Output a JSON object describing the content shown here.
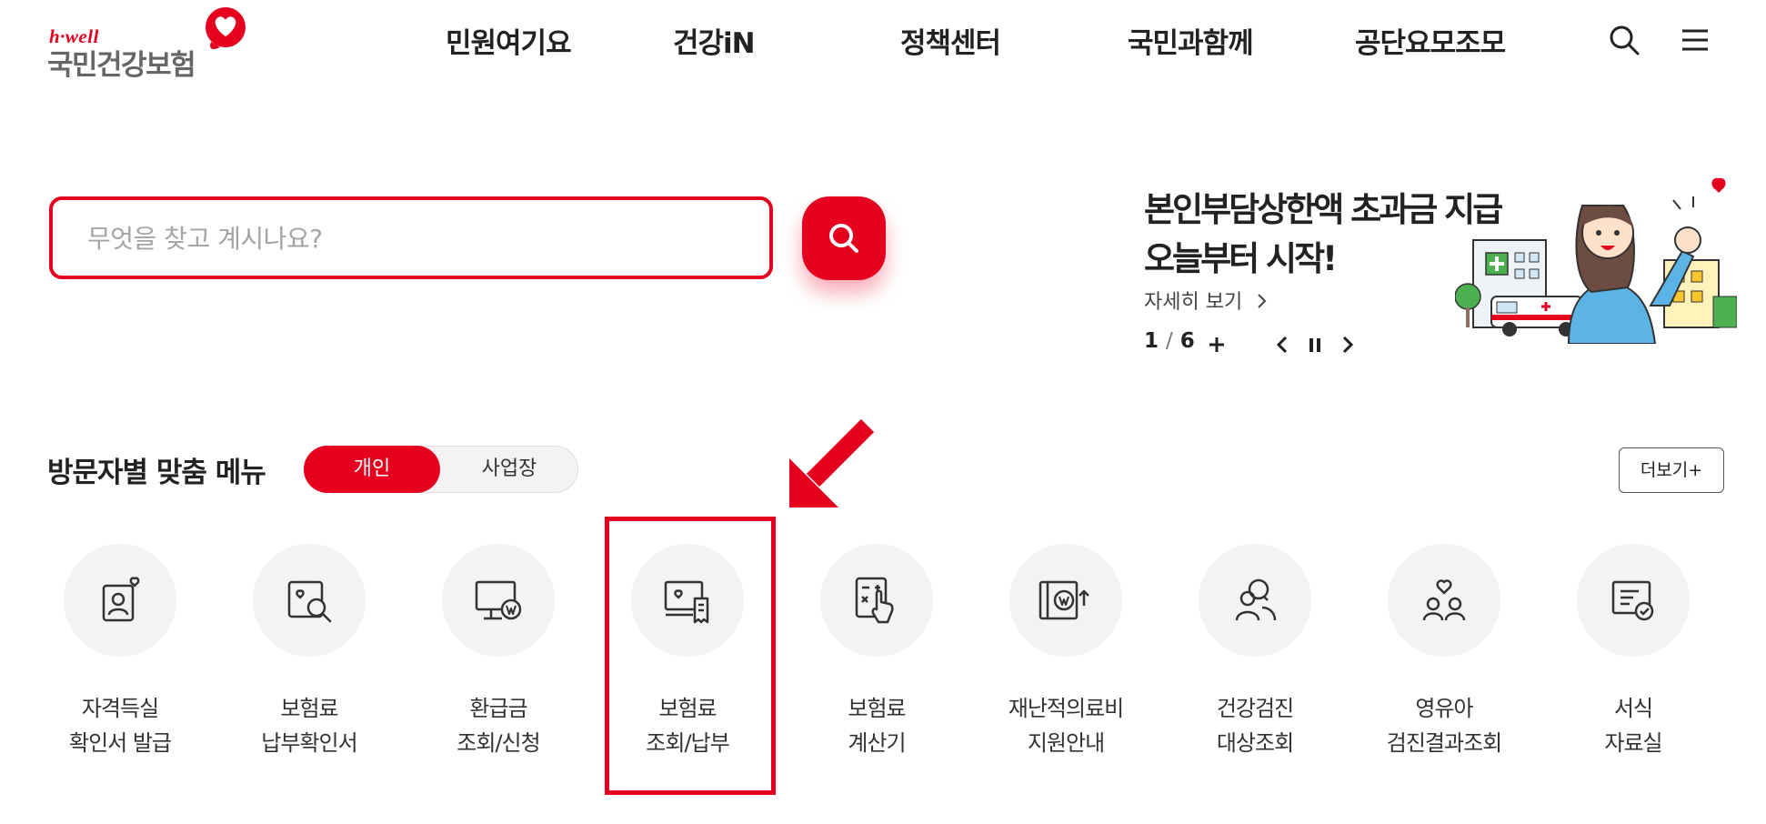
{
  "header": {
    "logo_small": "h·well",
    "logo_main": "국민건강보험",
    "nav": [
      "민원여기요",
      "건강iN",
      "정책센터",
      "국민과함께",
      "공단요모조모"
    ],
    "icons": [
      "search-icon",
      "hamburger-menu-icon"
    ]
  },
  "search": {
    "placeholder": "무엇을 찾고 계시나요?",
    "button_icon": "search-icon"
  },
  "banner": {
    "title_line1": "본인부담상한액 초과금 지급",
    "title_line2": "오늘부터 시작!",
    "more": "자세히 보기",
    "current": "1",
    "separator": "/",
    "total": "6",
    "controls": [
      "plus-icon",
      "prev-icon",
      "pause-icon",
      "next-icon"
    ]
  },
  "visitor_menu": {
    "title": "방문자별 맞춤 메뉴",
    "tab_active": "개인",
    "tab_inactive": "사업장",
    "more_button": "더보기+"
  },
  "quick_menu": [
    {
      "line1": "자격득실",
      "line2": "확인서 발급",
      "icon": "id-card-heart-icon"
    },
    {
      "line1": "보험료",
      "line2": "납부확인서",
      "icon": "document-search-icon"
    },
    {
      "line1": "환급금",
      "line2": "조회/신청",
      "icon": "monitor-won-icon"
    },
    {
      "line1": "보험료",
      "line2": "조회/납부",
      "icon": "monitor-receipt-icon"
    },
    {
      "line1": "보험료",
      "line2": "계산기",
      "icon": "calculator-hand-icon"
    },
    {
      "line1": "재난적의료비",
      "line2": "지원안내",
      "icon": "book-won-icon"
    },
    {
      "line1": "건강검진",
      "line2": "대상조회",
      "icon": "people-search-icon"
    },
    {
      "line1": "영유아",
      "line2": "검진결과조회",
      "icon": "family-heart-icon"
    },
    {
      "line1": "서식",
      "line2": "자료실",
      "icon": "form-check-icon"
    }
  ],
  "colors": {
    "brand_red": "#e5001f",
    "text_dark": "#222222",
    "icon_circle": "#f3f3f3"
  }
}
